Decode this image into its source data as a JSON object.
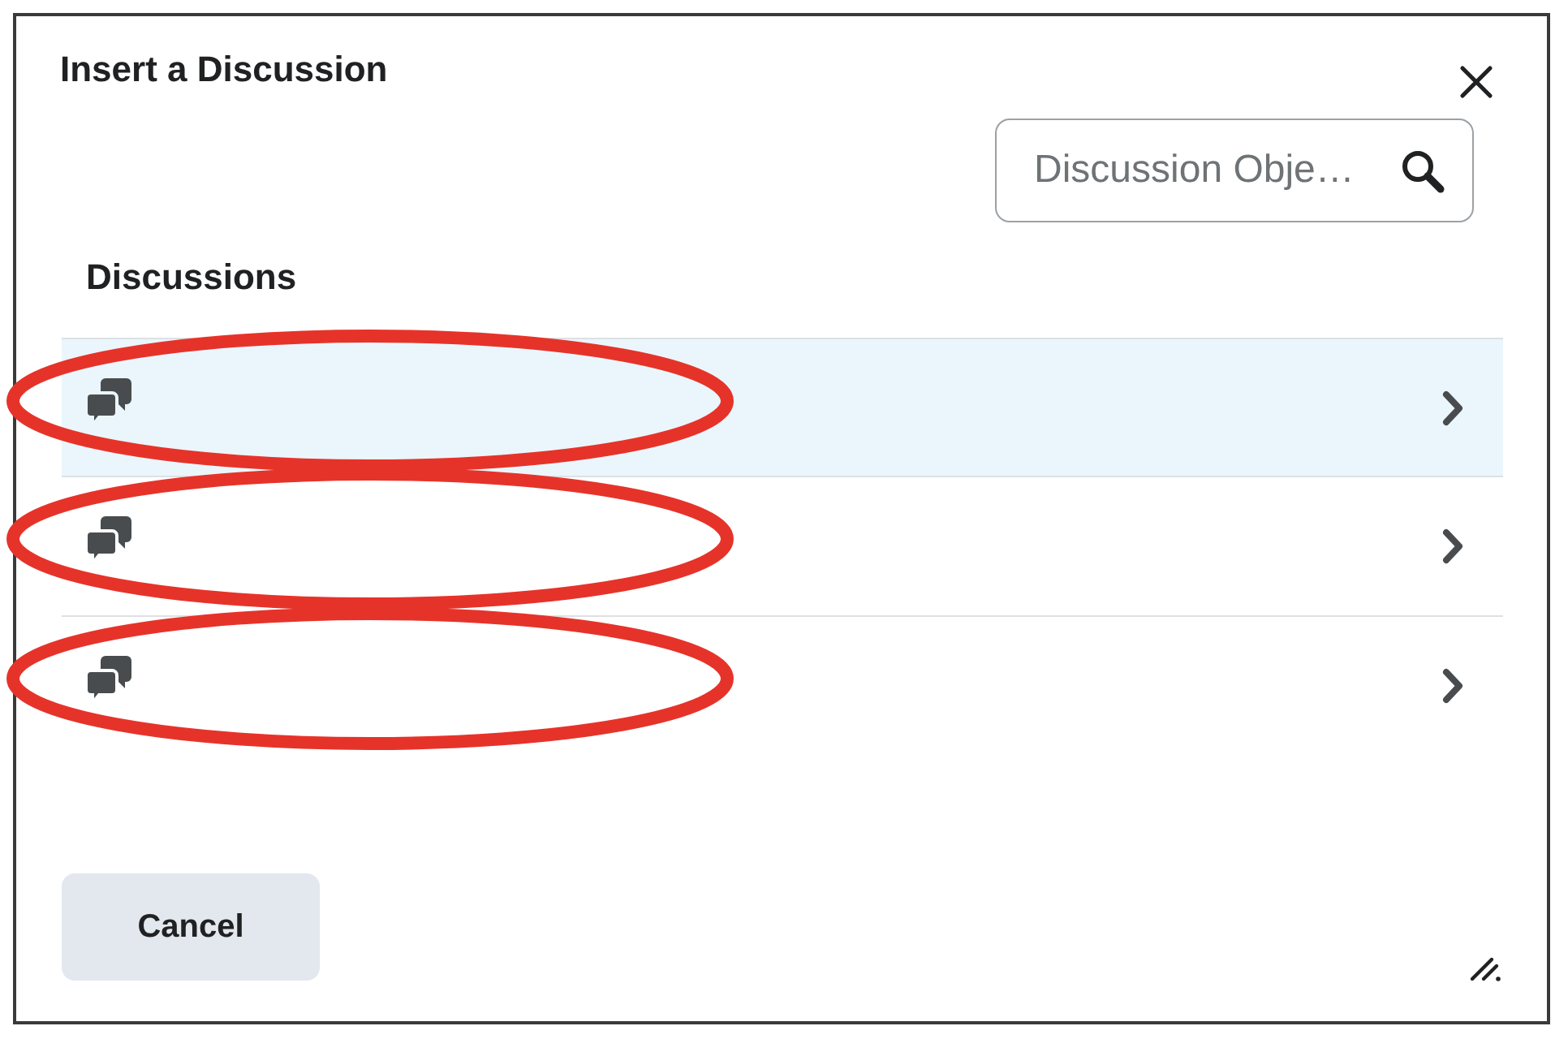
{
  "dialog": {
    "title": "Insert a Discussion"
  },
  "search": {
    "placeholder": "Discussion Obje…"
  },
  "discussions": {
    "heading": "Discussions",
    "items": [
      {
        "selected": true,
        "circled": true
      },
      {
        "selected": false,
        "circled": true
      },
      {
        "selected": false,
        "circled": true
      }
    ]
  },
  "buttons": [
    "Cancel"
  ]
}
